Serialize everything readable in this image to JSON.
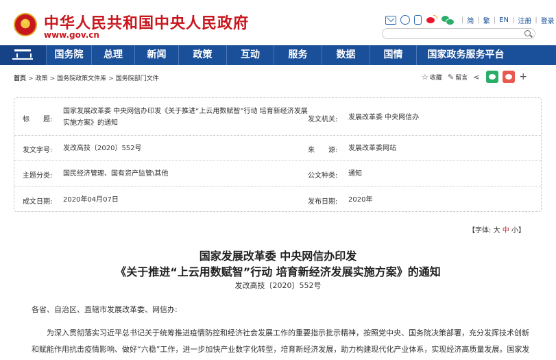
{
  "header": {
    "site_title": "中华人民共和国中央人民政府",
    "site_url": "www.gov.cn",
    "lang_simplified": "简",
    "lang_traditional": "繁",
    "lang_en": "EN",
    "register": "注册",
    "login": "登录",
    "search_placeholder": ""
  },
  "nav": {
    "items": [
      {
        "label": "国务院"
      },
      {
        "label": "总理"
      },
      {
        "label": "新闻"
      },
      {
        "label": "政策"
      },
      {
        "label": "互动"
      },
      {
        "label": "服务"
      },
      {
        "label": "数据"
      },
      {
        "label": "国情"
      },
      {
        "label": "国家政务服务平台"
      }
    ]
  },
  "breadcrumb": {
    "home": "首页",
    "items": [
      "政策",
      "国务院政策文件库",
      "国务院部门文件"
    ]
  },
  "toolbar": {
    "favorite": "收藏",
    "comment": "留言"
  },
  "info": {
    "title_key": "标　　题:",
    "title_value": "国家发展改革委 中央网信办印发《关于推进“上云用数赋智”行动 培育新经济发展实施方案》的通知",
    "issuer_key": "发文机关:",
    "issuer_value": "发展改革委 中央网信办",
    "doc_no_key": "发文字号:",
    "doc_no_value": "发改高技〔2020〕552号",
    "source_key": "来　　源:",
    "source_value": "发展改革委网站",
    "topic_key": "主题分类:",
    "topic_value": "国民经济管理、国有资产监管\\其他",
    "type_key": "公文种类:",
    "type_value": "通知",
    "written_key": "成文日期:",
    "written_value": "2020年04月07日",
    "published_key": "发布日期:",
    "published_value": "2020年"
  },
  "font_size": {
    "prefix": "【字体:",
    "large": "大",
    "medium": "中",
    "small": "小",
    "suffix": "】"
  },
  "article": {
    "title_line1": "国家发展改革委 中央网信办印发",
    "title_line2": "《关于推进“上云用数赋智”行动 培育新经济发展实施方案》的通知",
    "doc_code": "发改高技〔2020〕552号",
    "addressee": "各省、自治区、直辖市发展改革委、网信办:",
    "paragraph1": "为深入贯彻落实习近平总书记关于统筹推进疫情防控和经济社会发展工作的重要指示批示精神，按照党中央、国务院决策部署，充分发挥技术创新和赋能作用抗击疫情影响、做好“六稳”工作，进一步加快产业数字化转型，培育新经济发展，助力构建现代化产业体系，实现经济高质量发展。国家发展改革委、中央网信办研究制定了《关于推进“上云用数赋智”行动 培育新经济发展实施方案》，现印发给你们，请结合实际认真贯彻落实。"
  },
  "colors": {
    "brand_red": "#c8161d",
    "nav_blue": "#1a4f99"
  }
}
